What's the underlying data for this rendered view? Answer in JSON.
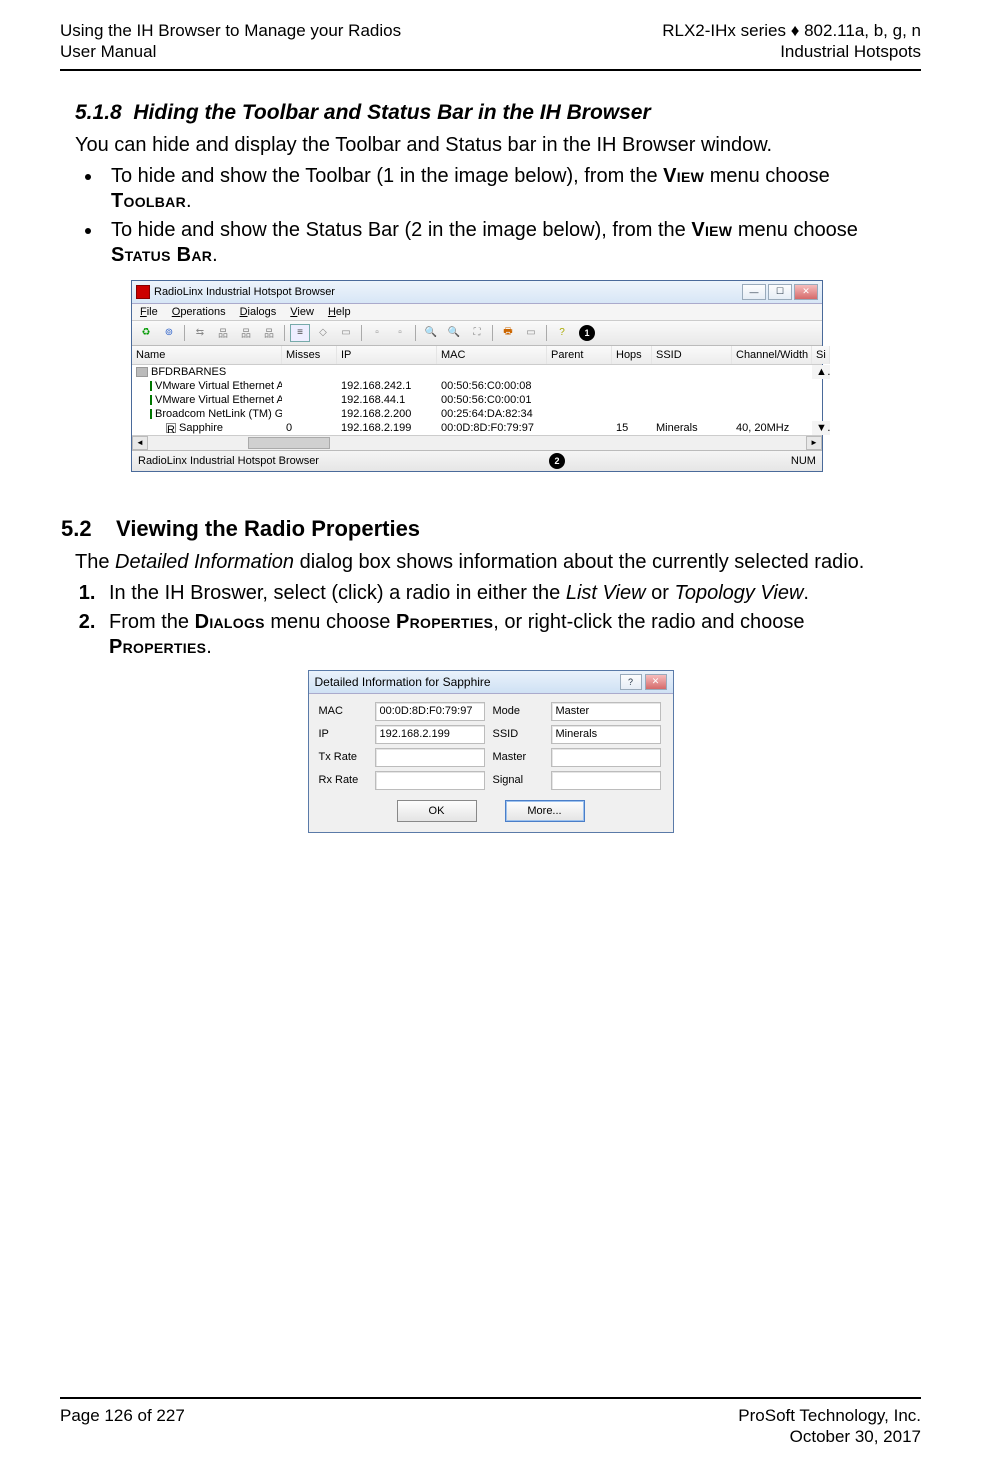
{
  "header": {
    "left_line1": "Using the IH Browser to Manage your Radios",
    "left_line2": "User Manual",
    "right_line1": "RLX2-IHx series ♦ 802.11a, b, g, n",
    "right_line2": "Industrial Hotspots"
  },
  "section518": {
    "number": "5.1.8",
    "title": "Hiding the Toolbar and Status Bar in the IH Browser",
    "intro": "You can hide and display the Toolbar and Status bar in the IH Browser window.",
    "bullet1_pre": "To hide and show the Toolbar (1 in the image below), from the ",
    "bullet1_menu": "View",
    "bullet1_mid": " menu choose ",
    "bullet1_item": "Toolbar",
    "bullet1_post": ".",
    "bullet2_pre": "To hide and show the Status Bar (2 in the image below), from the ",
    "bullet2_menu": "View",
    "bullet2_mid": " menu choose ",
    "bullet2_item": "Status Bar",
    "bullet2_post": "."
  },
  "ih_browser": {
    "title": "RadioLinx Industrial Hotspot Browser",
    "menus": {
      "file": "File",
      "operations": "Operations",
      "dialogs": "Dialogs",
      "view": "View",
      "help": "Help"
    },
    "callout1": "1",
    "columns": {
      "name": "Name",
      "misses": "Misses",
      "ip": "IP",
      "mac": "MAC",
      "parent": "Parent",
      "hops": "Hops",
      "ssid": "SSID",
      "chw": "Channel/Width",
      "si": "Si"
    },
    "rows": [
      {
        "name": "BFDRBARNES",
        "misses": "",
        "ip": "",
        "mac": "",
        "parent": "",
        "hops": "",
        "ssid": "",
        "chw": ""
      },
      {
        "name": "VMware Virtual Ethernet Adapter for ...",
        "misses": "",
        "ip": "192.168.242.1",
        "mac": "00:50:56:C0:00:08",
        "parent": "",
        "hops": "",
        "ssid": "",
        "chw": ""
      },
      {
        "name": "VMware Virtual Ethernet Adapter for ...",
        "misses": "",
        "ip": "192.168.44.1",
        "mac": "00:50:56:C0:00:01",
        "parent": "",
        "hops": "",
        "ssid": "",
        "chw": ""
      },
      {
        "name": "Broadcom NetLink (TM) Gigabit Eth...",
        "misses": "",
        "ip": "192.168.2.200",
        "mac": "00:25:64:DA:82:34",
        "parent": "",
        "hops": "",
        "ssid": "",
        "chw": ""
      },
      {
        "name": "Sapphire",
        "misses": "0",
        "ip": "192.168.2.199",
        "mac": "00:0D:8D:F0:79:97",
        "parent": "",
        "hops": "15",
        "ssid": "Minerals",
        "chw": "40, 20MHz"
      }
    ],
    "status_left": "RadioLinx Industrial Hotspot Browser",
    "callout2": "2",
    "status_right": "NUM"
  },
  "section52": {
    "number": "5.2",
    "title": "Viewing the Radio Properties",
    "intro_pre": "The ",
    "intro_em": "Detailed Information",
    "intro_post": " dialog box shows information about the currently selected radio.",
    "step1_pre": "In the IH Broswer, select (click) a radio in either the ",
    "step1_em1": "List View",
    "step1_mid": " or ",
    "step1_em2": "Topology View",
    "step1_post": ".",
    "step2_pre": "From the ",
    "step2_m1": "Dialogs",
    "step2_mid1": " menu choose ",
    "step2_m2": "Properties",
    "step2_mid2": ", or right-click the radio and choose ",
    "step2_m3": "Properties",
    "step2_post": "."
  },
  "detail_dialog": {
    "title": "Detailed Information for Sapphire",
    "labels": {
      "mac": "MAC",
      "ip": "IP",
      "tx": "Tx Rate",
      "rx": "Rx Rate",
      "mode": "Mode",
      "ssid": "SSID",
      "master": "Master",
      "signal": "Signal"
    },
    "values": {
      "mac": "00:0D:8D:F0:79:97",
      "ip": "192.168.2.199",
      "tx": "",
      "rx": "",
      "mode": "Master",
      "ssid": "Minerals",
      "master": "",
      "signal": ""
    },
    "buttons": {
      "ok": "OK",
      "more": "More..."
    }
  },
  "footer": {
    "left": "Page 126 of 227",
    "right_line1": "ProSoft Technology, Inc.",
    "right_line2": "October 30, 2017"
  }
}
